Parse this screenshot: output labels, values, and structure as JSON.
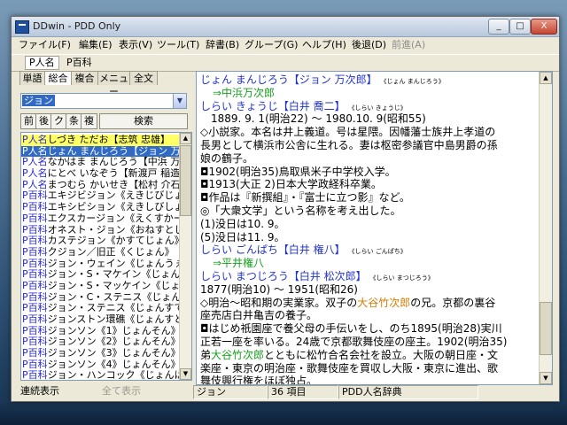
{
  "window": {
    "title": "DDwin - PDD Only",
    "controls": {
      "minimize": "_",
      "maximize": "□",
      "close": "X"
    }
  },
  "menu": [
    {
      "label": "ファイル(F)",
      "disabled": false
    },
    {
      "label": "編集(E)",
      "disabled": false
    },
    {
      "label": "表示(V)",
      "disabled": false
    },
    {
      "label": "ツール(T)",
      "disabled": false
    },
    {
      "label": "辞書(B)",
      "disabled": false
    },
    {
      "label": "グループ(G)",
      "disabled": false
    },
    {
      "label": "ヘルプ(H)",
      "disabled": false
    },
    {
      "label": "後退(D)",
      "disabled": false
    },
    {
      "label": "前進(A)",
      "disabled": true
    }
  ],
  "dict_tabs": [
    {
      "label": "P人名",
      "active": true
    },
    {
      "label": "P百科",
      "active": false
    }
  ],
  "search_tabs": [
    {
      "label": "単語",
      "active": false
    },
    {
      "label": "総合",
      "active": true
    },
    {
      "label": "複合",
      "active": false
    },
    {
      "label": "メニュー",
      "active": false
    },
    {
      "label": "全文",
      "active": false
    }
  ],
  "search": {
    "value": "ジョン",
    "filters": [
      "前",
      "後",
      "ク",
      "条",
      "複"
    ],
    "button": "検索"
  },
  "results": [
    {
      "tag": "P人名",
      "text": "しづき ただお【志筑 忠雄】",
      "state": "hilite"
    },
    {
      "tag": "P人名",
      "text": "じょん まんじろう【ジョン 万次郎】",
      "state": "selected"
    },
    {
      "tag": "P人名",
      "text": "なかはま まんじろう【中浜 万次郎】",
      "state": ""
    },
    {
      "tag": "P人名",
      "text": "にとべ いなぞう【新渡戸 稲造】",
      "state": ""
    },
    {
      "tag": "P人名",
      "text": "まつむら かいせき【松村 介石】",
      "state": ""
    },
    {
      "tag": "P百科",
      "text": "エキジビジョン《えきじびじょん》",
      "state": ""
    },
    {
      "tag": "P百科",
      "text": "エキシビション《えきしびしょん》",
      "state": ""
    },
    {
      "tag": "P百科",
      "text": "エクスカージョン《えくすかーじょん》",
      "state": ""
    },
    {
      "tag": "P百科",
      "text": "オネスト・ジョン《おねすとじょん》",
      "state": ""
    },
    {
      "tag": "P百科",
      "text": "カステジョン《かすてじょん》",
      "state": ""
    },
    {
      "tag": "P百科",
      "text": "クジョン／旧正《くじょん》",
      "state": ""
    },
    {
      "tag": "P百科",
      "text": "ジョン・ウェイン《じょんうぇいん》",
      "state": ""
    },
    {
      "tag": "P百科",
      "text": "ジョン・S・マケイン《じょんえすまけいん》",
      "state": ""
    },
    {
      "tag": "P百科",
      "text": "ジョン・S・マッケイン《じょんえすまっけいん》",
      "state": ""
    },
    {
      "tag": "P百科",
      "text": "ジョン・C・ステニス《じょんしーすてにす》",
      "state": ""
    },
    {
      "tag": "P百科",
      "text": "ジョン・ステニス《じょんすてにす》",
      "state": ""
    },
    {
      "tag": "P百科",
      "text": "ジョンストン環礁《じょんすとんかんしょう》",
      "state": ""
    },
    {
      "tag": "P百科",
      "text": "ジョンソン《1》じょんそん》",
      "state": ""
    },
    {
      "tag": "P百科",
      "text": "ジョンソン《2》じょんそん》",
      "state": ""
    },
    {
      "tag": "P百科",
      "text": "ジョンソン《3》じょんそん》",
      "state": ""
    },
    {
      "tag": "P百科",
      "text": "ジョンソン《4》じょんそん》",
      "state": ""
    },
    {
      "tag": "P百科",
      "text": "ジョン・ハンコック《じょんはんこっく》",
      "state": ""
    }
  ],
  "entry_lines": [
    {
      "type": "head",
      "text": "じょん まんじろう【ジョン 万次郎】",
      "reading": "《じょん まんじろう》"
    },
    {
      "type": "link",
      "text": "⇒中浜万次郎"
    },
    {
      "type": "head",
      "text": "しらい きょうじ【白井 喬二】",
      "reading": "《しらい きょうじ》"
    },
    {
      "type": "text",
      "text": "　1889. 9. 1(明治22) ～ 1980.10. 9(昭和55)"
    },
    {
      "type": "text",
      "text": "◇小説家。本名は井上義道。号は星隈。因幡藩士族井上孝道の"
    },
    {
      "type": "text",
      "text": "長男として横浜市公舎に生れる。妻は枢密参議官中島男爵の孫"
    },
    {
      "type": "text",
      "text": "娘の鶴子。"
    },
    {
      "type": "text",
      "text": "◘1902(明治35)鳥取県米子中学校入学。"
    },
    {
      "type": "text",
      "text": "◘1913(大正 2)日本大学政経科卒業。"
    },
    {
      "type": "text",
      "text": "◘作品は『新撰組』・『富士に立つ影』など。"
    },
    {
      "type": "text",
      "text": "◎「大衆文学」という名称を考え出した。"
    },
    {
      "type": "text",
      "text": "(1)没日は10. 9。"
    },
    {
      "type": "text",
      "text": "(5)没日は11. 9。"
    },
    {
      "type": "head",
      "text": "しらい ごんぱち【白井 権八】",
      "reading": "《しらい ごんぱち》"
    },
    {
      "type": "link",
      "text": "⇒平井権八"
    },
    {
      "type": "head",
      "text": "しらい まつじろう【白井 松次郎】",
      "reading": "《しらい まつじろう》"
    },
    {
      "type": "text",
      "text": "1877(明治10) ～ 1951(昭和26)"
    },
    {
      "type": "rich",
      "parts": [
        [
          "◇明治～昭和期の実業家。双子の",
          ""
        ],
        [
          "大谷竹次郎",
          "orange"
        ],
        [
          "の兄。京都の裏谷",
          ""
        ]
      ]
    },
    {
      "type": "text",
      "text": "座売店白井亀吉の養子。"
    },
    {
      "type": "text",
      "text": "◘はじめ祇園座で養父母の手伝いをし、のち1895(明治28)実川"
    },
    {
      "type": "text",
      "text": "正若一座を率いる。24歳で京都歌舞伎座の座主。1902(明治35)"
    },
    {
      "type": "rich",
      "parts": [
        [
          "弟",
          ""
        ],
        [
          "大谷竹次郎",
          "green"
        ],
        [
          "とともに松竹合名会社を設立。大阪の朝日座・文",
          ""
        ]
      ]
    },
    {
      "type": "text",
      "text": "楽座・東京の明治座・歌舞伎座を買収し大阪・東京に進出、歌"
    },
    {
      "type": "text",
      "text": "舞伎興行権をほぼ独占。"
    }
  ],
  "status": {
    "continuous": "連続表示",
    "show_all": "全て表示",
    "query": "ジョン",
    "count": "36 項目",
    "dictionary": "PDD人名辞典"
  }
}
